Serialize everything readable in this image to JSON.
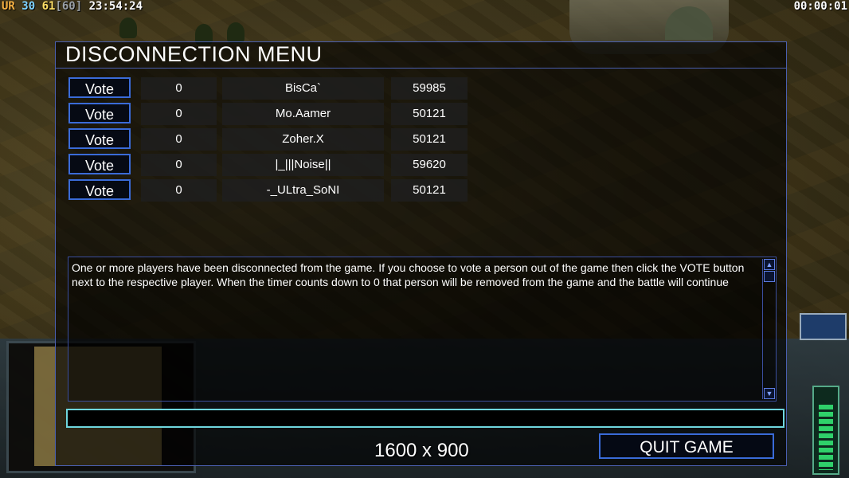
{
  "hud": {
    "prefix": "UR",
    "value_a": "30",
    "value_b": "61",
    "value_c": "[60]",
    "clock": "23:54:24",
    "game_timer": "00:00:01"
  },
  "dialog": {
    "title": "DISCONNECTION MENU",
    "players": [
      {
        "vote": "Vote",
        "timer": "0",
        "name": "BisCa`",
        "ping": "59985"
      },
      {
        "vote": "Vote",
        "timer": "0",
        "name": "Mo.Aamer",
        "ping": "50121"
      },
      {
        "vote": "Vote",
        "timer": "0",
        "name": "Zoher.X",
        "ping": "50121"
      },
      {
        "vote": "Vote",
        "timer": "0",
        "name": "|_|||Noise||",
        "ping": "59620"
      },
      {
        "vote": "Vote",
        "timer": "0",
        "name": "-_ULtra_SoNI",
        "ping": "50121"
      }
    ],
    "message": "One or more players have been disconnected from the game. If you choose to vote a person out of the game then click the VOTE button next to the respective player. When the timer counts down to 0 that person will be removed from the game and the battle will continue",
    "scroll_up": "▲",
    "scroll_down": "▼",
    "chat_value": "",
    "quit_label": "QUIT GAME"
  },
  "overlay": {
    "resolution": "1600 x 900"
  },
  "colors": {
    "dialog_border": "#4a5fb0",
    "button_border": "#3a6bd8",
    "chat_border": "#6fd6de"
  }
}
